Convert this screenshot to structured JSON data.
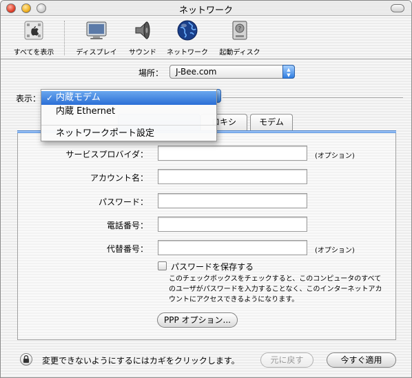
{
  "window": {
    "title": "ネットワーク"
  },
  "toolbar": {
    "items": [
      {
        "label": "すべてを表示",
        "icon": "apple-logo-icon"
      },
      {
        "label": "ディスプレイ",
        "icon": "display-icon"
      },
      {
        "label": "サウンド",
        "icon": "speaker-icon"
      },
      {
        "label": "ネットワーク",
        "icon": "globe-icon"
      },
      {
        "label": "起動ディスク",
        "icon": "hard-disk-icon"
      }
    ]
  },
  "location": {
    "label": "場所：",
    "value": "J-Bee.com"
  },
  "show": {
    "label": "表示：",
    "menu": {
      "items": [
        {
          "label": "内蔵モデム",
          "checked": true
        },
        {
          "label": "内蔵 Ethernet",
          "checked": false
        },
        {
          "label": "ネットワークポート設定",
          "checked": false
        }
      ],
      "check_glyph": "✓"
    }
  },
  "tabs": [
    {
      "label": "ロキシ"
    },
    {
      "label": "モデム"
    }
  ],
  "form": {
    "fields": [
      {
        "label": "サービスプロバイダ：",
        "value": "",
        "optional": "(オプション)"
      },
      {
        "label": "アカウント名：",
        "value": "",
        "optional": ""
      },
      {
        "label": "パスワード：",
        "value": "",
        "optional": ""
      },
      {
        "label": "電話番号：",
        "value": "",
        "optional": ""
      },
      {
        "label": "代替番号：",
        "value": "",
        "optional": "(オプション)"
      }
    ],
    "save_password": {
      "label": "パスワードを保存する",
      "checked": false,
      "help": "このチェックボックスをチェックすると、このコンピュータのすべてのユーザがパスワードを入力することなく、このインターネットアカウントにアクセスできるようになります。"
    },
    "ppp_button": "PPP オプション..."
  },
  "footer": {
    "lock_text": "変更できないようにするにはカギをクリックします。",
    "revert_button": "元に戻す",
    "apply_button": "今すぐ適用"
  },
  "colors": {
    "accent": "#2a6ed6",
    "tab_accent": "#5d97e0"
  }
}
